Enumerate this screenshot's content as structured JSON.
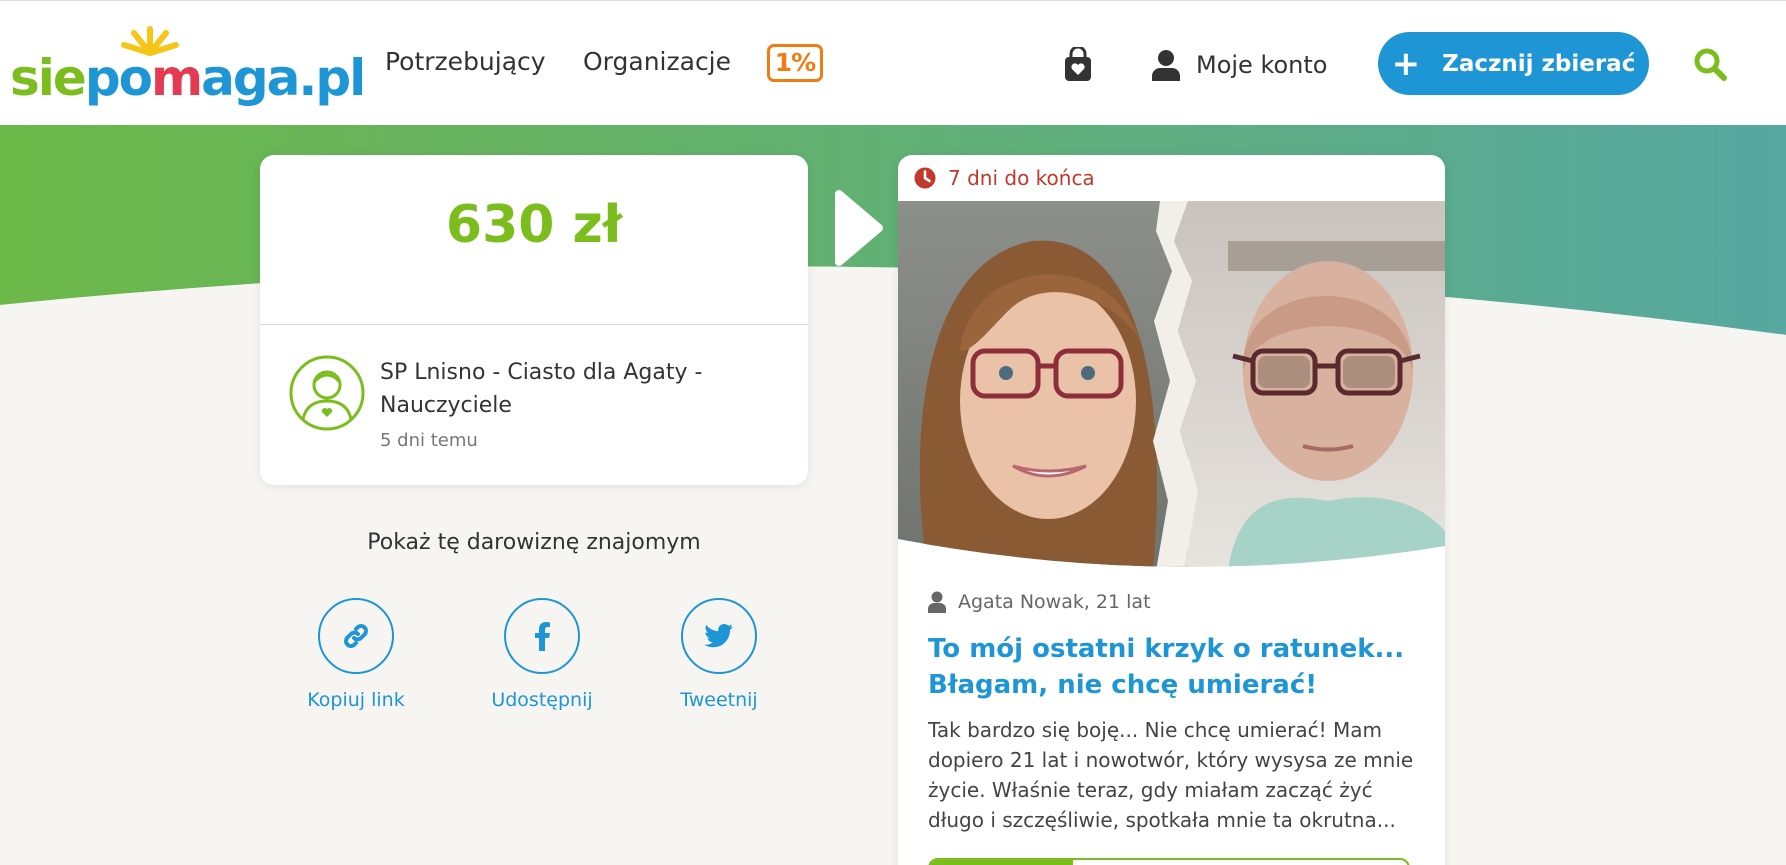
{
  "header": {
    "logo": {
      "part_sie": "sie",
      "part_po": "po",
      "part_heart": "m",
      "part_aga": "aga",
      "part_pl": ".pl"
    },
    "nav": {
      "potrzebujacy": "Potrzebujący",
      "organizacje": "Organizacje"
    },
    "badge_1pct": "1%",
    "account_label": "Moje konto",
    "cta_label": "Zacznij zbierać",
    "icons": {
      "bag": "heart-bag-icon",
      "user": "user-icon",
      "search": "search-icon",
      "plus": "plus-icon"
    }
  },
  "donation": {
    "amount": "630 zł",
    "donor_name": "SP Lnisno - Ciasto dla Agaty - Nauczyciele",
    "time_ago": "5 dni temu"
  },
  "share": {
    "title": "Pokaż tę darowiznę znajomym",
    "buttons": [
      {
        "label": "Kopiuj link",
        "icon": "link-icon"
      },
      {
        "label": "Udostępnij",
        "icon": "facebook-icon"
      },
      {
        "label": "Tweetnij",
        "icon": "twitter-icon"
      }
    ]
  },
  "fundraiser": {
    "deadline": "7 dni do końca",
    "author": "Agata Nowak, 21 lat",
    "title": "To mój ostatni krzyk o ratunek... Błagam, nie chcę umierać!",
    "description": "Tak bardzo się boję... Nie chcę umierać! Mam dopiero 21 lat i nowotwór, który wysysa ze mnie życie. Właśnie teraz, gdy miałam zacząć żyć długo i szczęśliwie, spotkała mnie ta okrutna...",
    "progress_fraction": 0.3
  },
  "colors": {
    "brand_green": "#7cbd1e",
    "brand_blue": "#1e96d6",
    "accent_orange": "#f07c12",
    "deadline_red": "#c0392b",
    "heart_red": "#e43a52",
    "band_gradient_start": "#6cb848",
    "band_gradient_end": "#56a8a0"
  }
}
